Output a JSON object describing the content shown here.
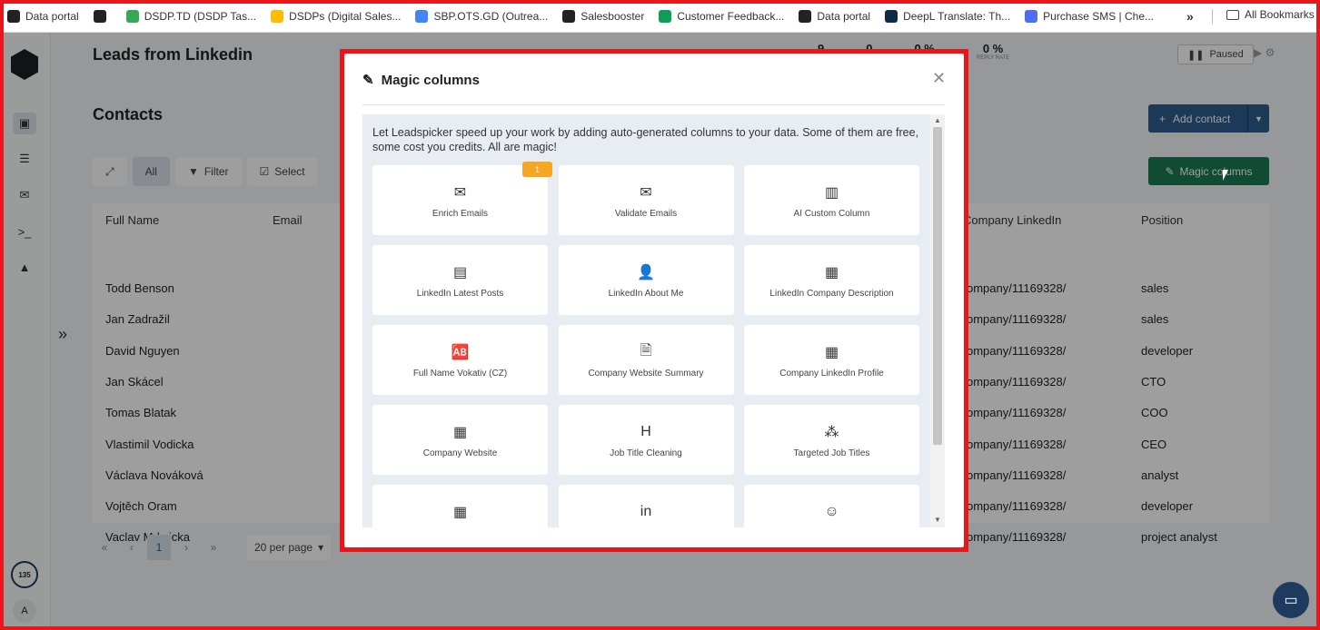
{
  "bookmarks": [
    {
      "label": "Data portal",
      "color": "#222222"
    },
    {
      "label": "",
      "color": "#222222"
    },
    {
      "label": "DSDP.TD (DSDP Tas...",
      "color": "#34a853"
    },
    {
      "label": "DSDPs (Digital Sales...",
      "color": "#fbbc04"
    },
    {
      "label": "SBP.OTS.GD (Outrea...",
      "color": "#4285f4"
    },
    {
      "label": "Salesbooster",
      "color": "#222222"
    },
    {
      "label": "Customer Feedback...",
      "color": "#0f9d58"
    },
    {
      "label": "Data portal",
      "color": "#222222"
    },
    {
      "label": "DeepL Translate: Th...",
      "color": "#0f2b46"
    },
    {
      "label": "Purchase SMS | Che...",
      "color": "#4e6ef2"
    }
  ],
  "bookmarks_more": "»",
  "bookmarks_all": "All Bookmarks",
  "app": {
    "page_title": "Leads from Linkedin",
    "stats": [
      {
        "value": "9",
        "label": ""
      },
      {
        "value": "0",
        "label": ""
      },
      {
        "value": "0 %",
        "label": ""
      },
      {
        "value": "0 %",
        "label": "REPLY RATE"
      }
    ],
    "paused_label": "Paused",
    "contacts_title": "Contacts",
    "add_contact_label": "Add contact",
    "magic_columns_label": "Magic columns",
    "toolbar": {
      "all": "All",
      "filter": "Filter",
      "select": "Select"
    },
    "columns": [
      "Full Name",
      "Email",
      "Company LinkedIn",
      "Position"
    ],
    "rows": [
      {
        "name": "Todd Benson",
        "linkedin": "ompany/11169328/",
        "position": "sales"
      },
      {
        "name": "Jan Zadražil",
        "linkedin": "ompany/11169328/",
        "position": "sales"
      },
      {
        "name": "David Nguyen",
        "linkedin": "ompany/11169328/",
        "position": "developer"
      },
      {
        "name": "Jan Skácel",
        "linkedin": "ompany/11169328/",
        "position": "CTO"
      },
      {
        "name": "Tomas Blatak",
        "linkedin": "ompany/11169328/",
        "position": "COO"
      },
      {
        "name": "Vlastimil Vodicka",
        "linkedin": "ompany/11169328/",
        "position": "CEO"
      },
      {
        "name": "Václava Nováková",
        "linkedin": "ompany/11169328/",
        "position": "analyst"
      },
      {
        "name": "Vojtěch Oram",
        "linkedin": "ompany/11169328/",
        "position": "developer"
      },
      {
        "name": "Vaclav Mrkvicka",
        "linkedin": "ompany/11169328/",
        "position": "project analyst"
      }
    ],
    "pager": {
      "current": "1",
      "per_page": "20 per page"
    },
    "sidebar_badge": "135",
    "avatar": "A"
  },
  "modal": {
    "title": "Magic columns",
    "intro": "Let Leadspicker speed up your work by adding auto-generated columns to your data. Some of them are free, some cost you credits. All are magic!",
    "credit_badge": "1",
    "cards": [
      {
        "label": "Enrich Emails",
        "icon": "✉"
      },
      {
        "label": "Validate Emails",
        "icon": "✉"
      },
      {
        "label": "AI Custom Column",
        "icon": "▥"
      },
      {
        "label": "LinkedIn Latest Posts",
        "icon": "▤"
      },
      {
        "label": "LinkedIn About Me",
        "icon": "👤"
      },
      {
        "label": "LinkedIn Company Description",
        "icon": "▦"
      },
      {
        "label": "Full Name Vokativ (CZ)",
        "icon": "🆎"
      },
      {
        "label": "Company Website Summary",
        "icon": "🗎"
      },
      {
        "label": "Company LinkedIn Profile",
        "icon": "▦"
      },
      {
        "label": "Company Website",
        "icon": "▦"
      },
      {
        "label": "Job Title Cleaning",
        "icon": "H"
      },
      {
        "label": "Targeted Job Titles",
        "icon": "⁂"
      },
      {
        "label": "",
        "icon": "▦"
      },
      {
        "label": "",
        "icon": "in"
      },
      {
        "label": "",
        "icon": "☺"
      }
    ]
  },
  "colors": {
    "primary": "#2f5c8f",
    "magic": "#1b7a53",
    "highlight": "#e8171b",
    "credit": "#f5a623"
  }
}
